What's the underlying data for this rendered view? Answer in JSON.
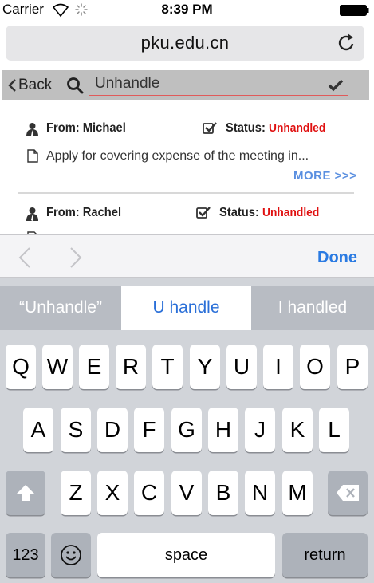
{
  "status_bar": {
    "carrier": "Carrier",
    "time": "8:39 PM"
  },
  "browser": {
    "url": "pku.edu.cn",
    "reload_icon": "reload-icon"
  },
  "nav": {
    "back_label": "Back",
    "search_value": "Unhandle"
  },
  "messages": [
    {
      "from": "From: Michael",
      "status_label": "Status: ",
      "status_value": "Unhandled",
      "description": "Apply for covering expense of the meeting in...",
      "more": "MORE >>>"
    },
    {
      "from": "From: Rachel",
      "status_label": "Status: ",
      "status_value": "Unhandled"
    }
  ],
  "accessory": {
    "done_label": "Done"
  },
  "keyboard": {
    "suggestions": [
      "“Unhandle”",
      "U handle",
      "I handled"
    ],
    "row1": [
      "Q",
      "W",
      "E",
      "R",
      "T",
      "Y",
      "U",
      "I",
      "O",
      "P"
    ],
    "row2": [
      "A",
      "S",
      "D",
      "F",
      "G",
      "H",
      "J",
      "K",
      "L"
    ],
    "row3": [
      "Z",
      "X",
      "C",
      "V",
      "B",
      "N",
      "M"
    ],
    "numbers_label": "123",
    "space_label": "space",
    "return_label": "return"
  },
  "colors": {
    "status_red": "#e01010",
    "link_blue": "#5a8fe0",
    "done_blue": "#2a7ae2",
    "keyboard_bg": "#d1d4d9"
  }
}
